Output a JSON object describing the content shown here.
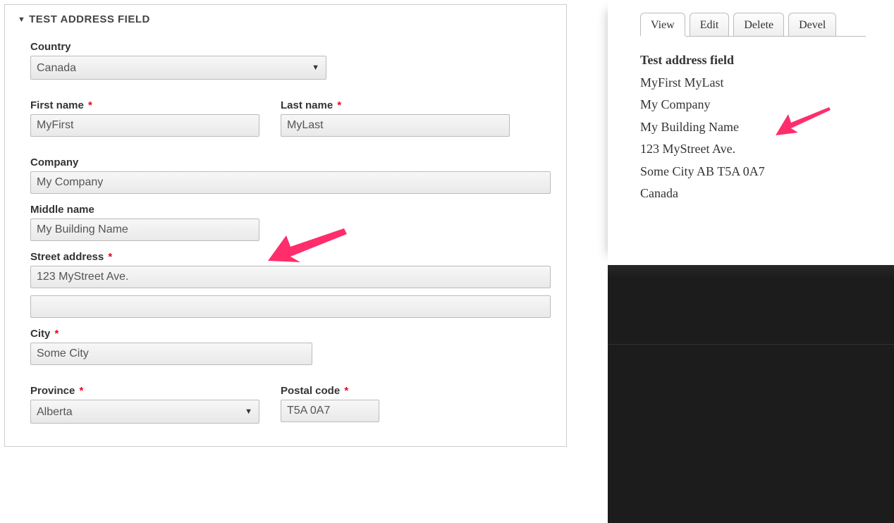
{
  "fieldset": {
    "title": "TEST ADDRESS FIELD"
  },
  "form": {
    "country": {
      "label": "Country",
      "value": "Canada"
    },
    "first_name": {
      "label": "First name",
      "value": "MyFirst",
      "required": true
    },
    "last_name": {
      "label": "Last name",
      "value": "MyLast",
      "required": true
    },
    "company": {
      "label": "Company",
      "value": "My Company"
    },
    "middle_name": {
      "label": "Middle name",
      "value": "My Building Name"
    },
    "street": {
      "label": "Street address",
      "value1": "123 MyStreet Ave.",
      "value2": "",
      "required": true
    },
    "city": {
      "label": "City",
      "value": "Some City",
      "required": true
    },
    "province": {
      "label": "Province",
      "value": "Alberta",
      "required": true
    },
    "postal": {
      "label": "Postal code",
      "value": "T5A 0A7",
      "required": true
    }
  },
  "required_marker": "*",
  "tabs": {
    "view": "View",
    "edit": "Edit",
    "delete": "Delete",
    "devel": "Devel",
    "active": "view"
  },
  "display": {
    "title": "Test address field",
    "line1": "MyFirst MyLast",
    "line2": "My Company",
    "line3": "My Building Name",
    "line4": "123 MyStreet Ave.",
    "line5": "Some City AB T5A 0A7",
    "line6": "Canada"
  }
}
